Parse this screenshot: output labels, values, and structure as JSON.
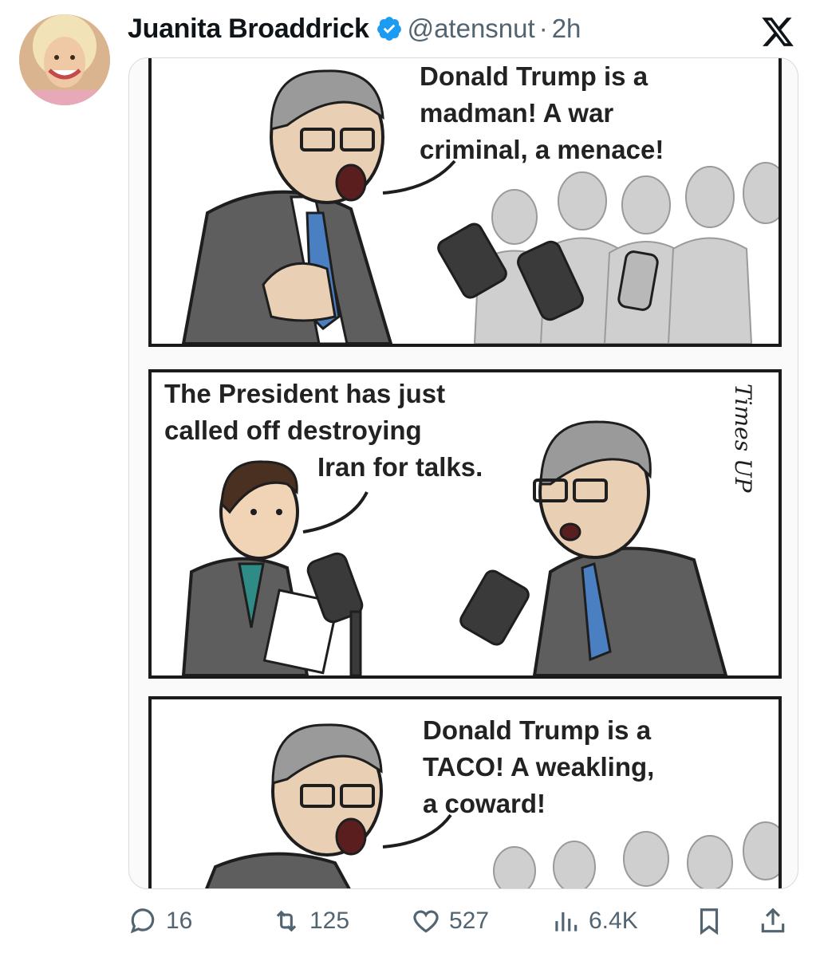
{
  "post": {
    "author_name": "Juanita Broaddrick",
    "handle": "@atensnut",
    "separator": "·",
    "time": "2h"
  },
  "media": {
    "panel1_caption": "Donald Trump is a\nmadman! A war\ncriminal, a menace!",
    "panel2_caption_line1": "The President has just\ncalled off destroying",
    "panel2_caption_line2": "Iran for talks.",
    "panel2_watermark": "Times UP",
    "panel3_caption": "Donald Trump is a\nTACO! A weakling,\na coward!"
  },
  "actions": {
    "replies": "16",
    "reposts": "125",
    "likes": "527",
    "views": "6.4K"
  },
  "colors": {
    "verified": "#1d9bf0",
    "muted_text": "#536471",
    "suit": "#5a5a5a",
    "tie": "#4a7fc1"
  }
}
